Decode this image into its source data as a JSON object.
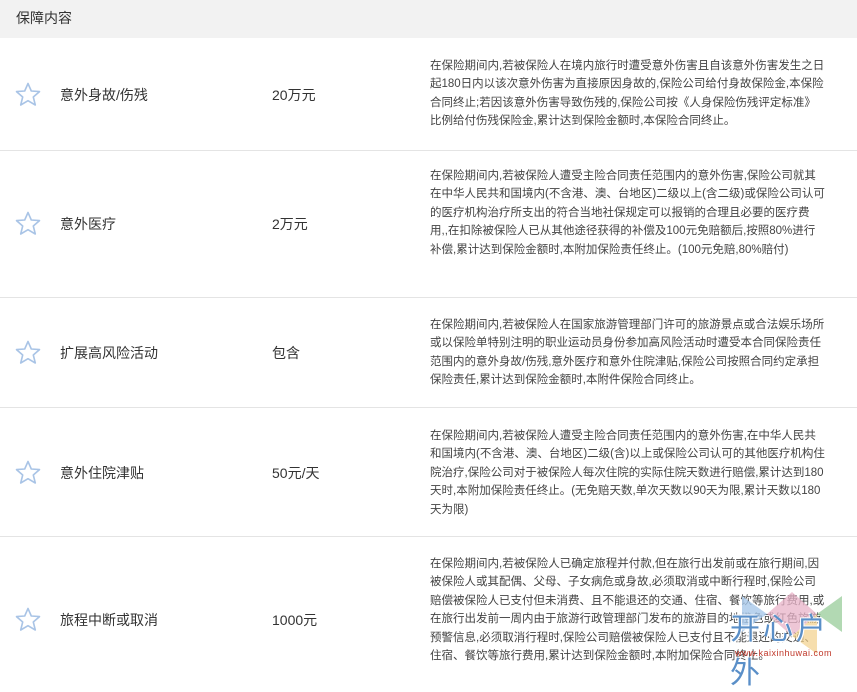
{
  "section_title": "保障内容",
  "rows": [
    {
      "name": "意外身故/伤残",
      "amount": "20万元",
      "description": "在保险期间内,若被保险人在境内旅行时遭受意外伤害且自该意外伤害发生之日起180日内以该次意外伤害为直接原因身故的,保险公司给付身故保险金,本保险合同终止;若因该意外伤害导致伤残的,保险公司按《人身保险伤残评定标准》比例给付伤残保险金,累计达到保险金额时,本保险合同终止。"
    },
    {
      "name": "意外医疗",
      "amount": "2万元",
      "description": "在保险期间内,若被保险人遭受主险合同责任范围内的意外伤害,保险公司就其在中华人民共和国境内(不含港、澳、台地区)二级以上(含二级)或保险公司认可的医疗机构治疗所支出的符合当地社保规定可以报销的合理且必要的医疗费用,,在扣除被保险人已从其他途径获得的补偿及100元免赔额后,按照80%进行补偿,累计达到保险金额时,本附加保险责任终止。(100元免赔,80%赔付)"
    },
    {
      "name": "扩展高风险活动",
      "amount": "包含",
      "description": "在保险期间内,若被保险人在国家旅游管理部门许可的旅游景点或合法娱乐场所或以保险单特别注明的职业运动员身份参加高风险活动时遭受本合同保险责任范围内的意外身故/伤残,意外医疗和意外住院津贴,保险公司按照合同约定承担保险责任,累计达到保险金额时,本附件保险合同终止。"
    },
    {
      "name": "意外住院津贴",
      "amount": "50元/天",
      "description": "在保险期间内,若被保险人遭受主险合同责任范围内的意外伤害,在中华人民共和国境内(不含港、澳、台地区)二级(含)以上或保险公司认可的其他医疗机构住院治疗,保险公司对于被保险人每次住院的实际住院天数进行赔偿,累计达到180天时,本附加保险责任终止。(无免赔天数,单次天数以90天为限,累计天数以180天为限)"
    },
    {
      "name": "旅程中断或取消",
      "amount": "1000元",
      "description": "在保险期间内,若被保险人已确定旅程并付款,但在旅行出发前或在旅行期间,因被保险人或其配偶、父母、子女病危或身故,必须取消或中断行程时,保险公司赔偿被保险人已支付但未消费、且不能退还的交通、住宿、餐饮等旅行费用,或在旅行出发前一周内由于旅游行政管理部门发布的旅游目的地橙色或红色旅游预警信息,必须取消行程时,保险公司赔偿被保险人已支付且不能退还的交通、住宿、餐饮等旅行费用,累计达到保险金额时,本附加保险合同终止。"
    }
  ],
  "watermark": {
    "text": "开心户外",
    "url": "www.kaixinhuwai.com"
  }
}
